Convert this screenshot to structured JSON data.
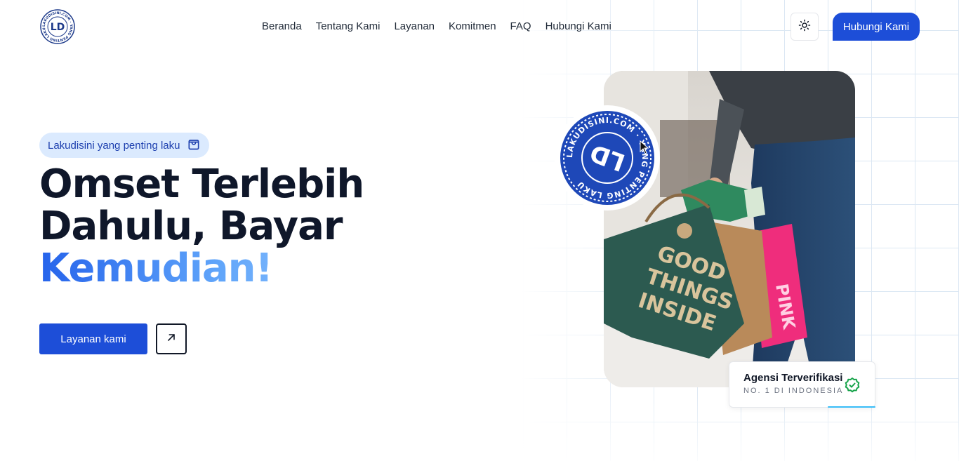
{
  "header": {
    "logo_text": "LD",
    "logo_ring_text": "LAKUDISINI.COM · YANG PENTING LAKU",
    "nav": [
      "Beranda",
      "Tentang Kami",
      "Layanan",
      "Komitmen",
      "FAQ",
      "Hubungi Kami"
    ],
    "theme_toggle_icon": "sun-icon",
    "contact_label": "Hubungi Kami"
  },
  "hero": {
    "pill_label": "Lakudisini yang penting laku",
    "pill_icon": "shopping-bag-icon",
    "headline_line1": "Omset Terlebih",
    "headline_line2": "Dahulu, Bayar",
    "headline_highlight": "Kemudian!",
    "cta_label": "Layanan kami",
    "arrow_icon": "arrow-up-right-icon"
  },
  "visual": {
    "stamp_text": "LD",
    "stamp_ring_text": "LAKUDISINI.COM · YANG PENTING LAKU",
    "bag_text": "GOOD THINGS INSIDE",
    "bag2_text": "PINK",
    "badge_title": "Agensi Terverifikasi",
    "badge_subtitle": "NO. 1 DI INDONESIA",
    "badge_icon": "verified-check-icon"
  },
  "colors": {
    "primary": "#1d4ed8",
    "pill_bg": "#dbeafe",
    "heading": "#0f172a",
    "verified": "#16a34a"
  }
}
